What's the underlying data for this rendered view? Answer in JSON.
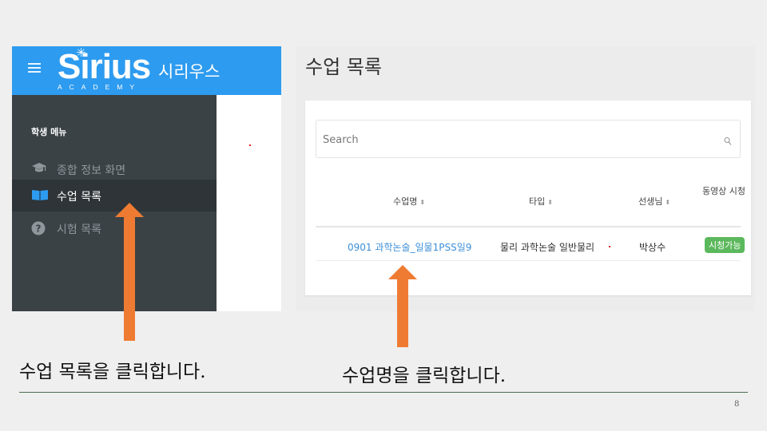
{
  "brand": {
    "logo_text": "Sirius",
    "logo_sub": "ACADEMY",
    "korean_name": "시리우스"
  },
  "sidebar": {
    "heading": "학생 메뉴",
    "items": [
      {
        "label": "종합 정보 화면",
        "icon": "graduation-cap-icon",
        "active": false
      },
      {
        "label": "수업 목록",
        "icon": "book-icon",
        "active": true
      },
      {
        "label": "시험 목록",
        "icon": "question-circle-icon",
        "active": false
      }
    ]
  },
  "main": {
    "page_title": "수업 목록",
    "search": {
      "placeholder": "Search",
      "value": ""
    },
    "table": {
      "columns": [
        "수업명",
        "타입",
        "선생님",
        "동영상 시청"
      ],
      "rows": [
        {
          "course": "0901 과학논술_일물1PSS일9",
          "type": "물리 과학논술 일반물리",
          "teacher": "박상수",
          "video": "시청가능"
        }
      ]
    }
  },
  "captions": {
    "left": "수업 목록을 클릭합니다.",
    "right": "수업명을 클릭합니다."
  },
  "page_number": "8",
  "colors": {
    "brand_blue": "#2d9bef",
    "sidebar_bg": "#3b4246",
    "arrow": "#ef7b32",
    "badge_green": "#5cb85c",
    "link_blue": "#3d8fd8"
  }
}
